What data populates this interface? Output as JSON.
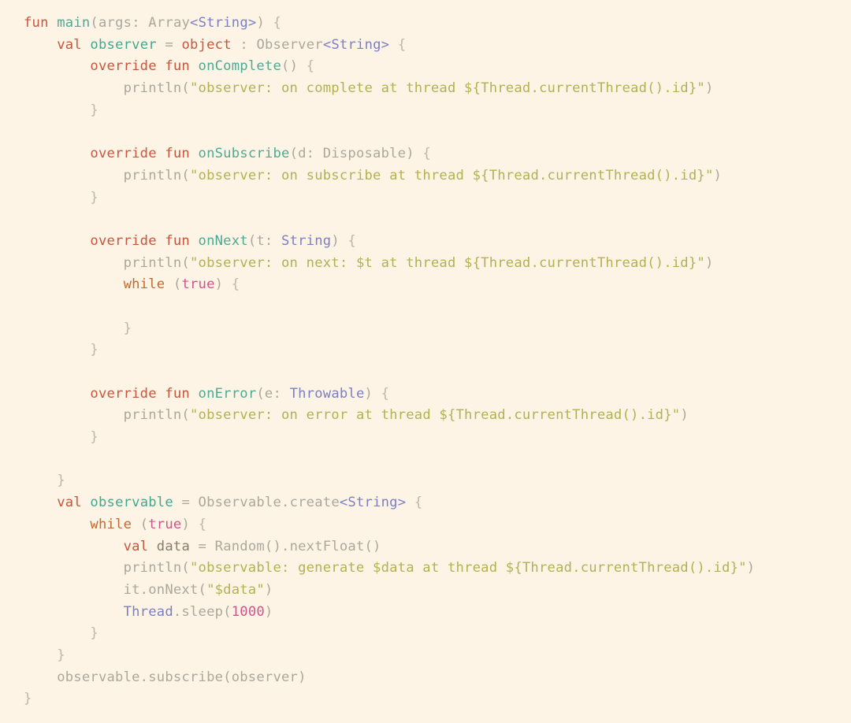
{
  "editor": {
    "language": "Kotlin",
    "background_color": "#FDF4E6",
    "font_family": "monospace",
    "font_size_px": 17,
    "line_height_px": 27.7,
    "theme_colors": {
      "keyword": "#C8563C",
      "function": "#4CAA95",
      "identifier": "#3EA98E",
      "type": "#7B7FC4",
      "plain": "#ADA79B",
      "local_variable": "#8A7B6B",
      "string": "#B5B052",
      "number_literal": "#D1538B",
      "brace": "#BDB7AA"
    }
  },
  "code": {
    "line_count": 32,
    "plain_text": "fun main(args: Array<String>) {\n    val observer = object : Observer<String> {\n        override fun onComplete() {\n            println(\"observer: on complete at thread ${Thread.currentThread().id}\")\n        }\n\n        override fun onSubscribe(d: Disposable) {\n            println(\"observer: on subscribe at thread ${Thread.currentThread().id}\")\n        }\n\n        override fun onNext(t: String) {\n            println(\"observer: on next: $t at thread ${Thread.currentThread().id}\")\n            while (true) {\n\n            }\n        }\n\n        override fun onError(e: Throwable) {\n            println(\"observer: on error at thread ${Thread.currentThread().id}\")\n        }\n\n    }\n    val observable = Observable.create<String> {\n        while (true) {\n            val data = Random().nextFloat()\n            println(\"observable: generate $data at thread ${Thread.currentThread().id}\")\n            it.onNext(\"$data\")\n            Thread.sleep(1000)\n        }\n    }\n    observable.subscribe(observer)\n}",
    "lines": [
      {
        "n": 1,
        "text": "fun main(args: Array<String>) {"
      },
      {
        "n": 2,
        "text": "    val observer = object : Observer<String> {"
      },
      {
        "n": 3,
        "text": "        override fun onComplete() {"
      },
      {
        "n": 4,
        "text": "            println(\"observer: on complete at thread ${Thread.currentThread().id}\")"
      },
      {
        "n": 5,
        "text": "        }"
      },
      {
        "n": 6,
        "text": ""
      },
      {
        "n": 7,
        "text": "        override fun onSubscribe(d: Disposable) {"
      },
      {
        "n": 8,
        "text": "            println(\"observer: on subscribe at thread ${Thread.currentThread().id}\")"
      },
      {
        "n": 9,
        "text": "        }"
      },
      {
        "n": 10,
        "text": ""
      },
      {
        "n": 11,
        "text": "        override fun onNext(t: String) {"
      },
      {
        "n": 12,
        "text": "            println(\"observer: on next: $t at thread ${Thread.currentThread().id}\")"
      },
      {
        "n": 13,
        "text": "            while (true) {"
      },
      {
        "n": 14,
        "text": ""
      },
      {
        "n": 15,
        "text": "            }"
      },
      {
        "n": 16,
        "text": "        }"
      },
      {
        "n": 17,
        "text": ""
      },
      {
        "n": 18,
        "text": "        override fun onError(e: Throwable) {"
      },
      {
        "n": 19,
        "text": "            println(\"observer: on error at thread ${Thread.currentThread().id}\")"
      },
      {
        "n": 20,
        "text": "        }"
      },
      {
        "n": 21,
        "text": ""
      },
      {
        "n": 22,
        "text": "    }"
      },
      {
        "n": 23,
        "text": "    val observable = Observable.create<String> {"
      },
      {
        "n": 24,
        "text": "        while (true) {"
      },
      {
        "n": 25,
        "text": "            val data = Random().nextFloat()"
      },
      {
        "n": 26,
        "text": "            println(\"observable: generate $data at thread ${Thread.currentThread().id}\")"
      },
      {
        "n": 27,
        "text": "            it.onNext(\"$data\")"
      },
      {
        "n": 28,
        "text": "            Thread.sleep(1000)"
      },
      {
        "n": 29,
        "text": "        }"
      },
      {
        "n": 30,
        "text": "    }"
      },
      {
        "n": 31,
        "text": "    observable.subscribe(observer)"
      },
      {
        "n": 32,
        "text": "}"
      }
    ],
    "tokens": [
      [
        [
          "kw",
          "fun"
        ],
        [
          "plain",
          " "
        ],
        [
          "fn",
          "main"
        ],
        [
          "plain",
          "("
        ],
        [
          "plain",
          "args"
        ],
        [
          "plain",
          ": "
        ],
        [
          "plain",
          "Array"
        ],
        [
          "type",
          "<String>"
        ],
        [
          "plain",
          ") "
        ],
        [
          "brace",
          "{"
        ]
      ],
      [
        [
          "plain",
          "    "
        ],
        [
          "kw",
          "val"
        ],
        [
          "plain",
          " "
        ],
        [
          "ident",
          "observer"
        ],
        [
          "plain",
          " "
        ],
        [
          "plain",
          "= "
        ],
        [
          "kw",
          "object"
        ],
        [
          "plain",
          " : "
        ],
        [
          "plain",
          "Observer"
        ],
        [
          "type",
          "<String>"
        ],
        [
          "plain",
          " "
        ],
        [
          "brace",
          "{"
        ]
      ],
      [
        [
          "plain",
          "        "
        ],
        [
          "kw",
          "override fun"
        ],
        [
          "plain",
          " "
        ],
        [
          "fn",
          "onComplete"
        ],
        [
          "plain",
          "() "
        ],
        [
          "brace",
          "{"
        ]
      ],
      [
        [
          "plain",
          "            "
        ],
        [
          "plain",
          "println"
        ],
        [
          "plain",
          "("
        ],
        [
          "str",
          "\"observer: on complete at thread ${Thread.currentThread().id}\""
        ],
        [
          "plain",
          ")"
        ]
      ],
      [
        [
          "plain",
          "        "
        ],
        [
          "brace",
          "}"
        ]
      ],
      [
        [
          "blank",
          ""
        ]
      ],
      [
        [
          "plain",
          "        "
        ],
        [
          "kw",
          "override fun"
        ],
        [
          "plain",
          " "
        ],
        [
          "fn",
          "onSubscribe"
        ],
        [
          "plain",
          "(d: Disposable) "
        ],
        [
          "brace",
          "{"
        ]
      ],
      [
        [
          "plain",
          "            "
        ],
        [
          "plain",
          "println"
        ],
        [
          "plain",
          "("
        ],
        [
          "str",
          "\"observer: on subscribe at thread ${Thread.currentThread().id}\""
        ],
        [
          "plain",
          ")"
        ]
      ],
      [
        [
          "plain",
          "        "
        ],
        [
          "brace",
          "}"
        ]
      ],
      [
        [
          "blank",
          ""
        ]
      ],
      [
        [
          "plain",
          "        "
        ],
        [
          "kw",
          "override fun"
        ],
        [
          "plain",
          " "
        ],
        [
          "fn",
          "onNext"
        ],
        [
          "plain",
          "(t: "
        ],
        [
          "type",
          "String"
        ],
        [
          "plain",
          ") "
        ],
        [
          "brace",
          "{"
        ]
      ],
      [
        [
          "plain",
          "            "
        ],
        [
          "plain",
          "println"
        ],
        [
          "plain",
          "("
        ],
        [
          "str",
          "\"observer: on next: $t at thread ${Thread.currentThread().id}\""
        ],
        [
          "plain",
          ")"
        ]
      ],
      [
        [
          "plain",
          "            "
        ],
        [
          "kw2",
          "while"
        ],
        [
          "plain",
          " ("
        ],
        [
          "num",
          "true"
        ],
        [
          "plain",
          ") "
        ],
        [
          "brace",
          "{"
        ]
      ],
      [
        [
          "blank",
          ""
        ]
      ],
      [
        [
          "plain",
          "            "
        ],
        [
          "brace",
          "}"
        ]
      ],
      [
        [
          "plain",
          "        "
        ],
        [
          "brace",
          "}"
        ]
      ],
      [
        [
          "blank",
          ""
        ]
      ],
      [
        [
          "plain",
          "        "
        ],
        [
          "kw",
          "override fun"
        ],
        [
          "plain",
          " "
        ],
        [
          "fn",
          "onError"
        ],
        [
          "plain",
          "(e: "
        ],
        [
          "type",
          "Throwable"
        ],
        [
          "plain",
          ") "
        ],
        [
          "brace",
          "{"
        ]
      ],
      [
        [
          "plain",
          "            "
        ],
        [
          "plain",
          "println"
        ],
        [
          "plain",
          "("
        ],
        [
          "str",
          "\"observer: on error at thread ${Thread.currentThread().id}\""
        ],
        [
          "plain",
          ")"
        ]
      ],
      [
        [
          "plain",
          "        "
        ],
        [
          "brace",
          "}"
        ]
      ],
      [
        [
          "blank",
          ""
        ]
      ],
      [
        [
          "plain",
          "    "
        ],
        [
          "brace",
          "}"
        ]
      ],
      [
        [
          "plain",
          "    "
        ],
        [
          "kw",
          "val"
        ],
        [
          "plain",
          " "
        ],
        [
          "ident",
          "observable"
        ],
        [
          "plain",
          " = Observable.create"
        ],
        [
          "type",
          "<String>"
        ],
        [
          "plain",
          " "
        ],
        [
          "brace",
          "{"
        ]
      ],
      [
        [
          "plain",
          "        "
        ],
        [
          "kw2",
          "while"
        ],
        [
          "plain",
          " ("
        ],
        [
          "num",
          "true"
        ],
        [
          "plain",
          ") "
        ],
        [
          "brace",
          "{"
        ]
      ],
      [
        [
          "plain",
          "            "
        ],
        [
          "kw",
          "val"
        ],
        [
          "plain",
          " "
        ],
        [
          "dark",
          "data"
        ],
        [
          "plain",
          " = Random().nextFloat()"
        ]
      ],
      [
        [
          "plain",
          "            "
        ],
        [
          "plain",
          "println("
        ],
        [
          "str",
          "\"observable: generate $data at thread ${Thread.currentThread().id}\""
        ],
        [
          "plain",
          ")"
        ]
      ],
      [
        [
          "plain",
          "            "
        ],
        [
          "plain",
          "it.onNext("
        ],
        [
          "str",
          "\"$data\""
        ],
        [
          "plain",
          ")"
        ]
      ],
      [
        [
          "plain",
          "            "
        ],
        [
          "type",
          "Thread"
        ],
        [
          "plain",
          ".sleep("
        ],
        [
          "num",
          "1000"
        ],
        [
          "plain",
          ")"
        ]
      ],
      [
        [
          "plain",
          "        "
        ],
        [
          "brace",
          "}"
        ]
      ],
      [
        [
          "plain",
          "    "
        ],
        [
          "brace",
          "}"
        ]
      ],
      [
        [
          "plain",
          "    "
        ],
        [
          "plain",
          "observable.subscribe(observer)"
        ]
      ],
      [
        [
          "brace",
          "}"
        ]
      ]
    ]
  }
}
